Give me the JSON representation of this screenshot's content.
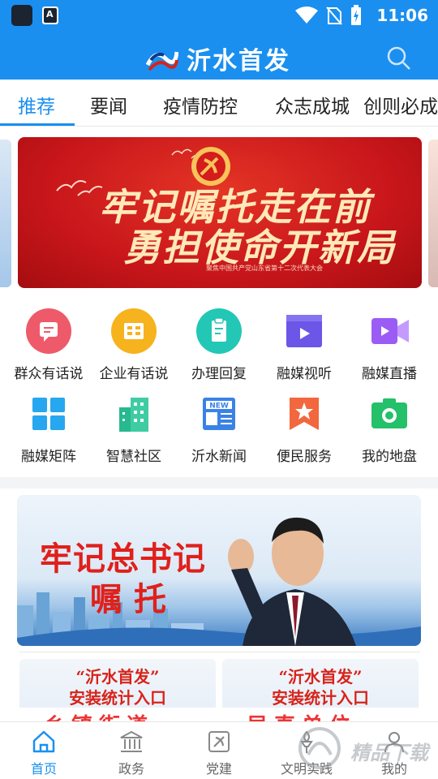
{
  "status_bar": {
    "time": "11:06",
    "notification_icon_letter": "A",
    "icons": [
      "app-notification-icon",
      "text-notification-icon",
      "wifi-icon",
      "no-sim-icon",
      "battery-charging-icon"
    ]
  },
  "app_bar": {
    "title": "沂水首发",
    "logo_icon": "yishui-logo-icon",
    "search_icon": "search-icon"
  },
  "tabs": [
    {
      "label": "推荐",
      "active": true
    },
    {
      "label": "要闻",
      "active": false
    },
    {
      "label": "疫情防控",
      "active": false
    },
    {
      "label": "众志成城",
      "active": false
    },
    {
      "label": "创则必成",
      "active": false
    }
  ],
  "colors": {
    "primary": "#1a8ff0",
    "banner_red": "#c8161b",
    "text_dark": "#222222",
    "promo_red": "#d8231a"
  },
  "carousel": {
    "banner_line1": "牢记嘱托走在前",
    "banner_line2": "勇担使命开新局",
    "banner_caption": "聚焦中国共产党山东省第十二次代表大会"
  },
  "shortcuts": [
    {
      "label": "群众有话说",
      "icon": "chat-bubble-icon",
      "color": "#ee5a6a"
    },
    {
      "label": "企业有话说",
      "icon": "building-doc-icon",
      "color": "#f6b31e"
    },
    {
      "label": "办理回复",
      "icon": "clipboard-icon",
      "color": "#23c7b6"
    },
    {
      "label": "融媒视听",
      "icon": "video-player-icon",
      "color": "#6b56e8"
    },
    {
      "label": "融媒直播",
      "icon": "video-camera-icon",
      "color": "#9b5cf5"
    },
    {
      "label": "融媒矩阵",
      "icon": "grid-matrix-icon",
      "color": "#26a7ef"
    },
    {
      "label": "智慧社区",
      "icon": "community-building-icon",
      "color": "#27b98f"
    },
    {
      "label": "沂水新闻",
      "icon": "newspaper-icon",
      "color": "#3b82e6"
    },
    {
      "label": "便民服务",
      "icon": "star-bookmark-icon",
      "color": "#f2673d"
    },
    {
      "label": "我的地盘",
      "icon": "camera-icon",
      "color": "#24c06a"
    }
  ],
  "feature_banner": {
    "line1": "牢记总书记",
    "line2": "嘱托"
  },
  "promo_cards": [
    {
      "quote": "“沂水首发”",
      "subtitle": "安装统计入口",
      "strip": "乡镇街道"
    },
    {
      "quote": "“沂水首发”",
      "subtitle": "安装统计入口",
      "strip": "局直单位"
    }
  ],
  "bottom_nav": [
    {
      "label": "首页",
      "icon": "home-icon",
      "active": true
    },
    {
      "label": "政务",
      "icon": "government-building-icon",
      "active": false
    },
    {
      "label": "党建",
      "icon": "party-emblem-icon",
      "active": false
    },
    {
      "label": "文明实践",
      "icon": "torch-icon",
      "active": false
    },
    {
      "label": "我的",
      "icon": "user-profile-icon",
      "active": false
    }
  ],
  "watermark": {
    "text": "精品下载"
  }
}
